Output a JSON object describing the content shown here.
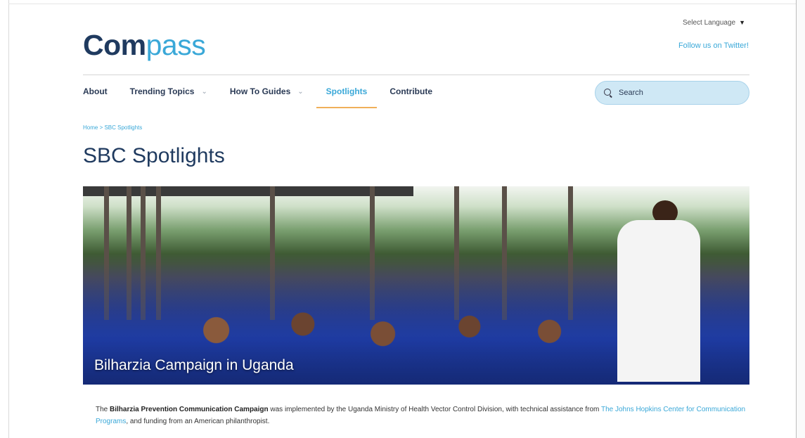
{
  "header": {
    "logo_part1": "Com",
    "logo_part2": "pass",
    "language_select": "Select Language",
    "follow_link": "Follow us on Twitter!"
  },
  "nav": {
    "items": [
      {
        "label": "About",
        "has_dropdown": false
      },
      {
        "label": "Trending Topics",
        "has_dropdown": true
      },
      {
        "label": "How To Guides",
        "has_dropdown": true
      },
      {
        "label": "Spotlights",
        "has_dropdown": false,
        "active": true
      },
      {
        "label": "Contribute",
        "has_dropdown": false
      }
    ],
    "search_placeholder": "Search"
  },
  "breadcrumb": "Home > SBC Spotlights",
  "page": {
    "title": "SBC Spotlights"
  },
  "spotlight": {
    "caption": "Bilharzia Campaign in Uganda",
    "desc_bold": "Bilharzia Prevention Communication Campaign",
    "desc_text1": "The",
    "desc_text2": "was implemented by the Uganda Ministry of Health Vector Control Division, with technical assistance from",
    "desc_link": "The Johns Hopkins Center for Communication Programs",
    "desc_text3": ", and funding from an American philanthropist."
  },
  "colors": {
    "brand_dark": "#1f3a5f",
    "brand_light": "#3aa8d8",
    "active_underline": "#f0b05a",
    "search_bg": "#cfe8f5"
  },
  "icons": {
    "search": "search-icon",
    "dropdown": "chevron-down-icon",
    "select_caret": "caret-down-icon"
  }
}
